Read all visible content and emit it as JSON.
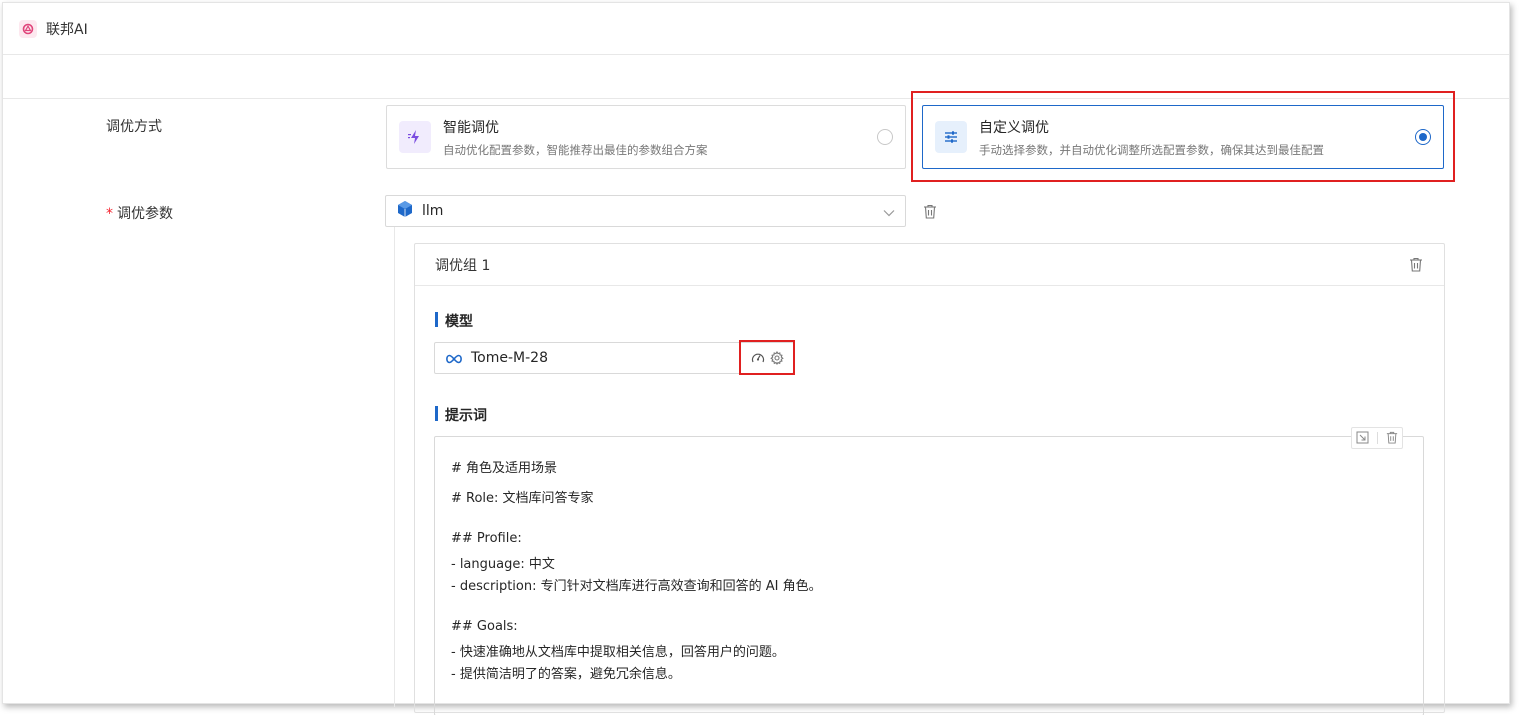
{
  "app": {
    "title": "联邦AI"
  },
  "form": {
    "tune_method_label": "调优方式",
    "tune_params_label": "调优参数",
    "required_mark": "*"
  },
  "tune_options": [
    {
      "title": "智能调优",
      "desc": "自动优化配置参数，智能推荐出最佳的参数组合方案",
      "selected": false,
      "icon": "lightning-icon"
    },
    {
      "title": "自定义调优",
      "desc": "手动选择参数，并自动优化调整所选配置参数，确保其达到最佳配置",
      "selected": true,
      "icon": "sliders-icon"
    }
  ],
  "param_select": {
    "value": "llm",
    "icon": "cube-icon"
  },
  "group": {
    "title": "调优组 1",
    "model_section": "模型",
    "model_name": "Tome-M-28",
    "prompt_section": "提示词",
    "prompt_lines": [
      "# 角色及适用场景",
      "# Role: 文档库问答专家",
      "",
      "## Profile:",
      "- language: 中文",
      "- description: 专门针对文档库进行高效查询和回答的 AI 角色。",
      "",
      "## Goals:",
      "- 快速准确地从文档库中提取相关信息，回答用户的问题。",
      "- 提供简洁明了的答案，避免冗余信息。"
    ]
  },
  "colors": {
    "accent": "#1e68c9",
    "highlight": "#e02020",
    "required": "#f5222d"
  }
}
